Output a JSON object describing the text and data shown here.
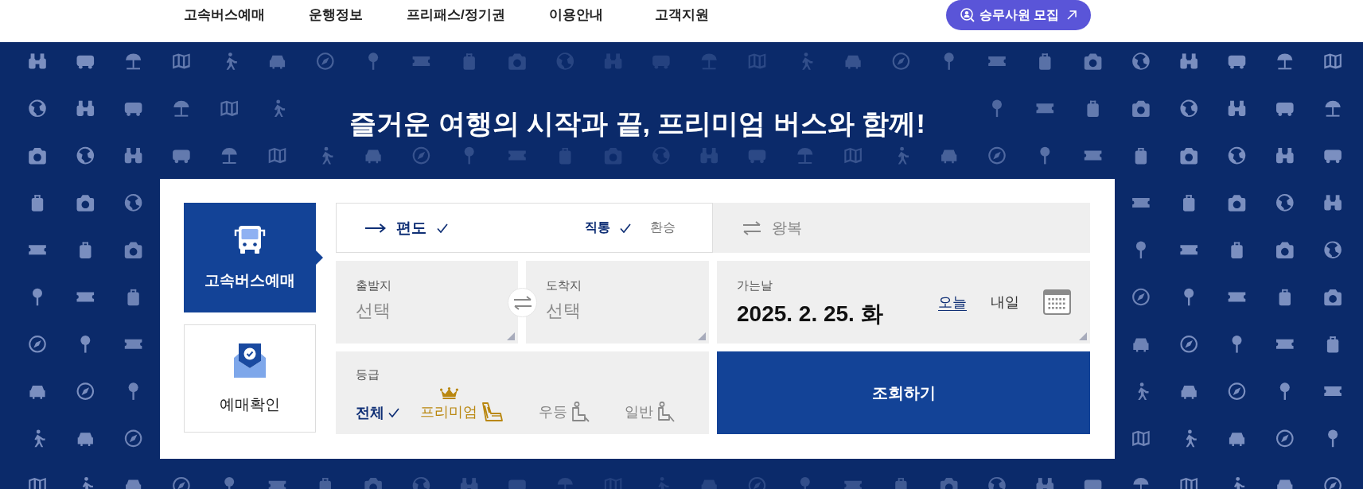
{
  "header": {
    "nav": [
      {
        "label": "고속버스예매"
      },
      {
        "label": "운행정보"
      },
      {
        "label": "프리패스/정기권"
      },
      {
        "label": "이용안내"
      },
      {
        "label": "고객지원"
      }
    ],
    "recruit_button": {
      "label": "승무사원 모집"
    }
  },
  "banner": {
    "headline": "즐거운 여행의 시작과 끝, 프리미엄 버스와 함께!"
  },
  "side_tabs": [
    {
      "label": "고속버스예매",
      "kind": "bus",
      "selected": true
    },
    {
      "label": "예매확인",
      "kind": "envelope",
      "selected": false
    }
  ],
  "trip_type": [
    {
      "label": "편도",
      "kind": "oneway",
      "selected": true,
      "route_options": [
        {
          "label": "직통",
          "selected": true
        },
        {
          "label": "환승",
          "selected": false
        }
      ]
    },
    {
      "label": "왕복",
      "kind": "roundtrip",
      "selected": false
    }
  ],
  "departure": {
    "label": "출발지",
    "placeholder": "선택"
  },
  "arrival": {
    "label": "도착지",
    "placeholder": "선택"
  },
  "date": {
    "label": "가는날",
    "value": "2025. 2. 25. 화",
    "shortcuts": [
      {
        "label": "오늘",
        "selected": true
      },
      {
        "label": "내일",
        "selected": false
      }
    ]
  },
  "grade": {
    "label": "등급",
    "options": [
      {
        "label": "전체",
        "kind": "all",
        "selected": true
      },
      {
        "label": "프리미엄",
        "kind": "premium",
        "selected": false
      },
      {
        "label": "우등",
        "kind": "deluxe",
        "selected": false
      },
      {
        "label": "일반",
        "kind": "standard",
        "selected": false
      }
    ]
  },
  "search_button": {
    "label": "조회하기"
  }
}
